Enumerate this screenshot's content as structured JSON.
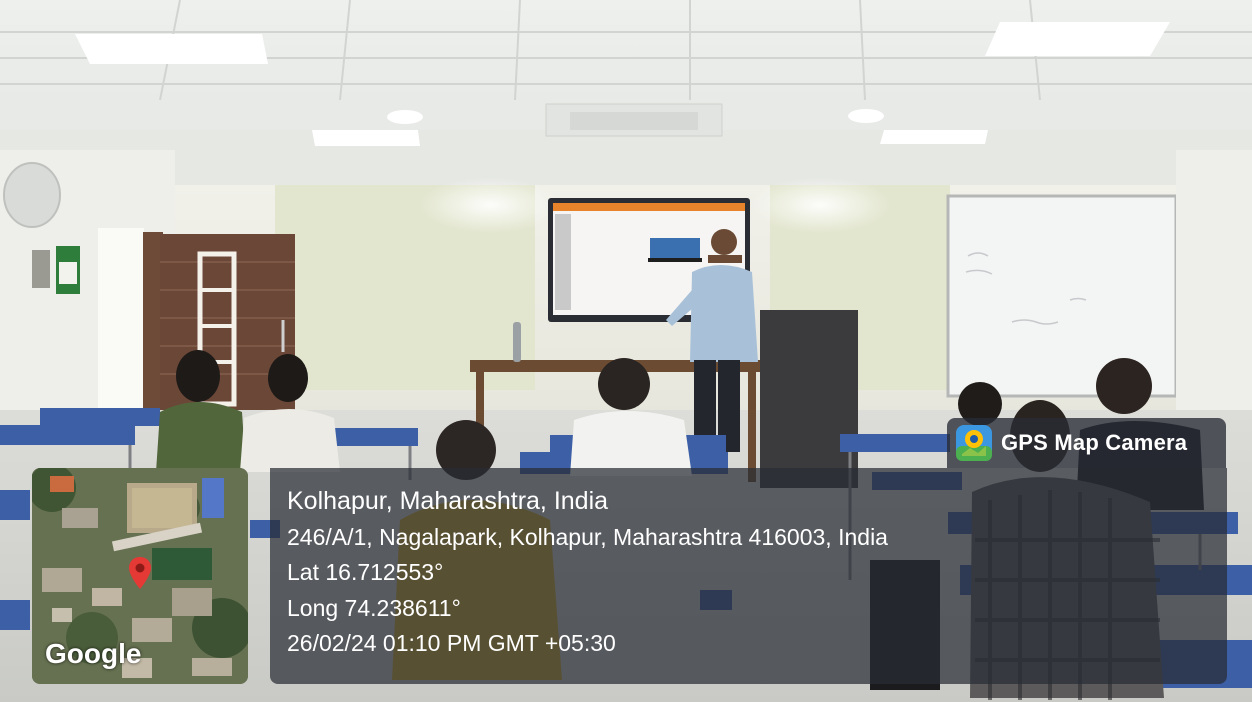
{
  "overlay": {
    "app_name": "GPS Map Camera",
    "location_title": "Kolhapur, Maharashtra, India",
    "address": "246/A/1, Nagalapark, Kolhapur, Maharashtra 416003, India",
    "latitude": "Lat 16.712553°",
    "longitude": "Long 74.238611°",
    "datetime": "26/02/24 01:10 PM GMT +05:30",
    "map_brand": "Google"
  },
  "icons": [
    "gps-map-camera-app-icon",
    "map-pin-icon"
  ],
  "colors": {
    "overlay_bg": "#282c34",
    "pin": "#e53935",
    "desk_blue": "#3d5fa6",
    "wall": "#ecece6",
    "screen": "#2a2d33"
  }
}
